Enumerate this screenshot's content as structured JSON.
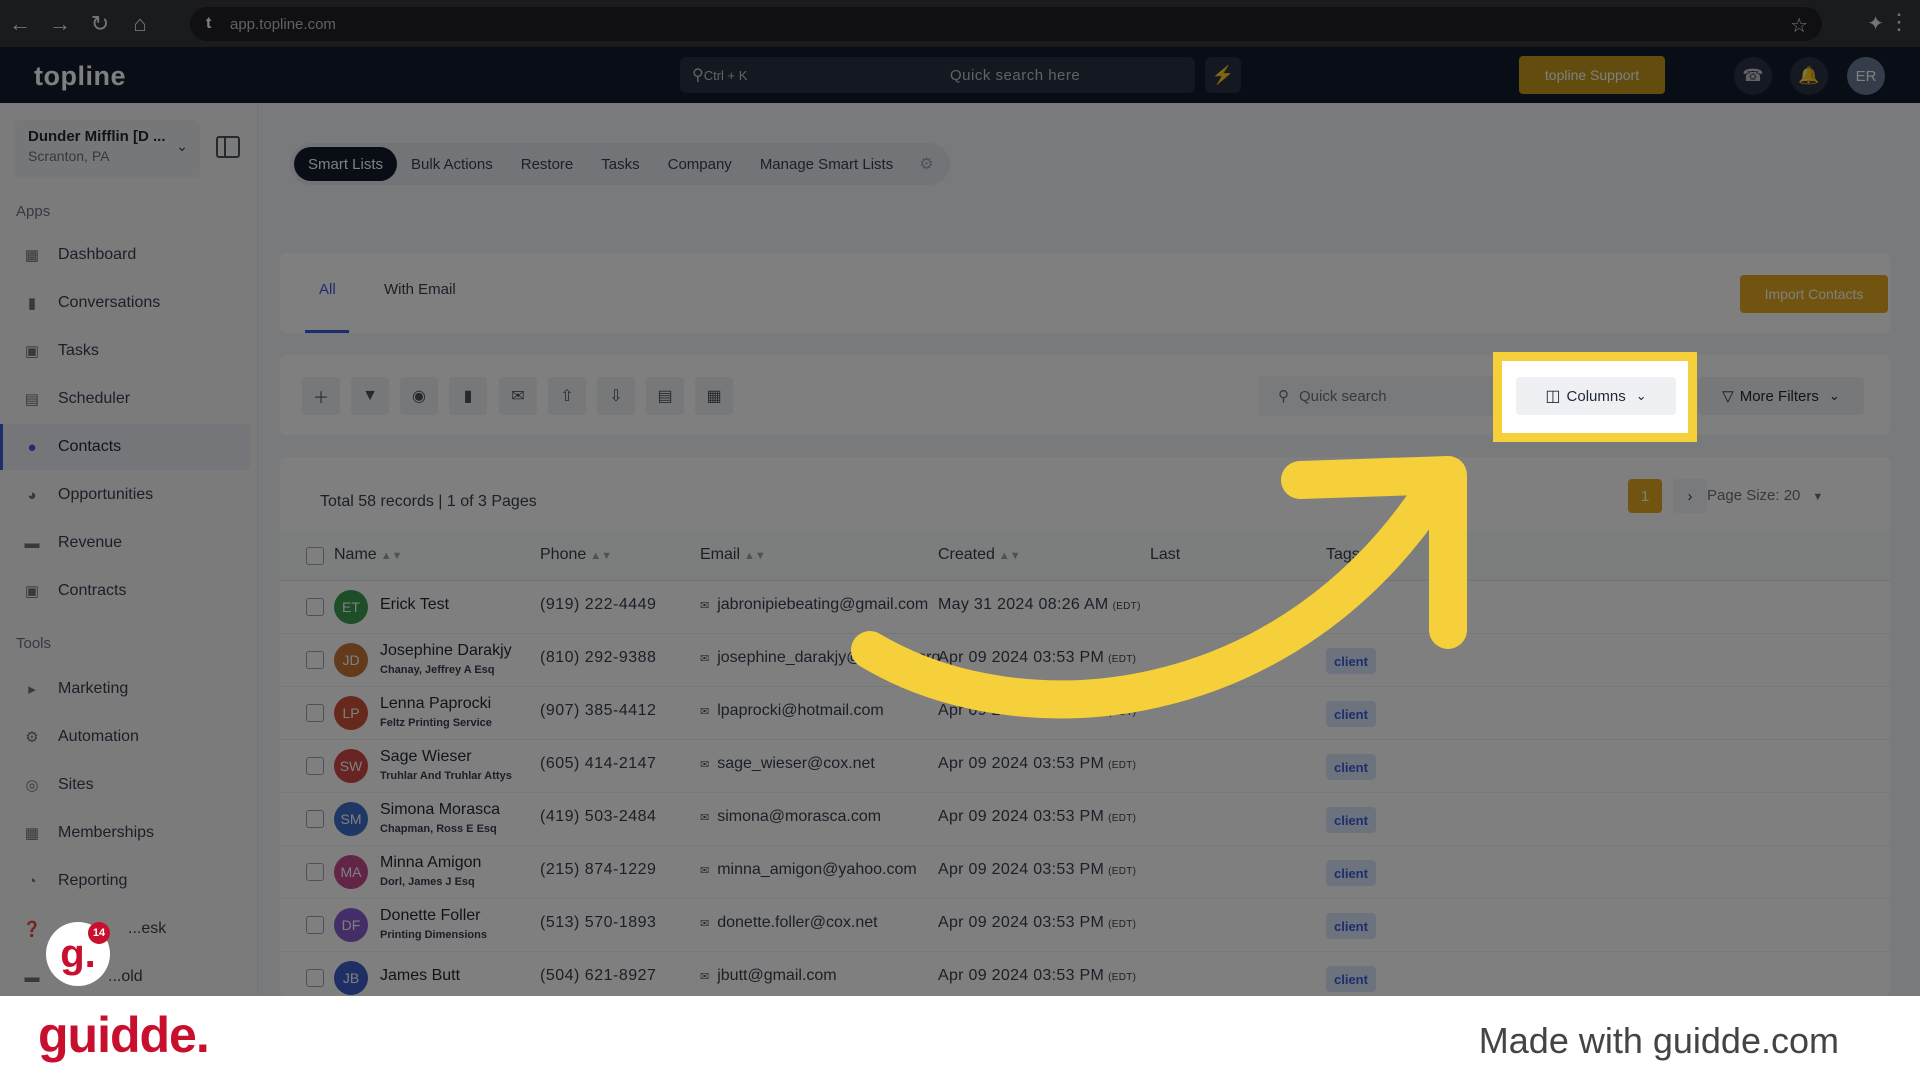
{
  "browser": {
    "url": "app.topline.com",
    "favicon": "t"
  },
  "app": {
    "logo": "topline",
    "search_placeholder": "Quick search here",
    "search_shortcut": "Ctrl + K",
    "support_label": "topline Support",
    "avatar_initials": "ER"
  },
  "sidebar": {
    "location_name": "Dunder Mifflin [D ...",
    "location_sub": "Scranton, PA",
    "apps_label": "Apps",
    "tools_label": "Tools",
    "apps": [
      {
        "label": "Dashboard",
        "icon": "dashboard-icon"
      },
      {
        "label": "Conversations",
        "icon": "chat-icon"
      },
      {
        "label": "Tasks",
        "icon": "tasks-icon"
      },
      {
        "label": "Scheduler",
        "icon": "calendar-icon"
      },
      {
        "label": "Contacts",
        "icon": "contacts-icon"
      },
      {
        "label": "Opportunities",
        "icon": "opportunities-icon"
      },
      {
        "label": "Revenue",
        "icon": "revenue-icon"
      },
      {
        "label": "Contracts",
        "icon": "contracts-icon"
      }
    ],
    "tools": [
      {
        "label": "Marketing",
        "icon": "megaphone-icon"
      },
      {
        "label": "Automation",
        "icon": "automation-icon"
      },
      {
        "label": "Sites",
        "icon": "globe-icon"
      },
      {
        "label": "Memberships",
        "icon": "memberships-icon"
      },
      {
        "label": "Reporting",
        "icon": "reporting-icon"
      },
      {
        "label": "...esk",
        "icon": "helpdesk-icon"
      },
      {
        "label": "...old",
        "icon": "misc-icon"
      }
    ]
  },
  "subnav": [
    "Smart Lists",
    "Bulk Actions",
    "Restore",
    "Tasks",
    "Company",
    "Manage Smart Lists"
  ],
  "tabs": [
    "All",
    "With Email"
  ],
  "import_label": "Import Contacts",
  "toolbar": {
    "quick_search": "Quick search",
    "columns_label": "Columns",
    "more_filters_label": "More Filters"
  },
  "table": {
    "total_text": "Total 58 records | 1 of 3 Pages",
    "current_page": "1",
    "page_size_text": "Page Size: 20",
    "headers": [
      "Name",
      "Phone",
      "Email",
      "Created",
      "Last",
      "Tags"
    ],
    "rows": [
      {
        "initials": "ET",
        "color": "#3a9d4f",
        "name": "Erick Test",
        "company": "",
        "phone": "(919) 222-4449",
        "email": "jabronipiebeating@gmail.com",
        "created": "May 31 2024 08:26 AM",
        "tz": "(EDT)",
        "tag": ""
      },
      {
        "initials": "JD",
        "color": "#c9743a",
        "name": "Josephine Darakjy",
        "company": "Chanay, Jeffrey A Esq",
        "phone": "(810) 292-9388",
        "email": "josephine_darakjy@darakjy.org",
        "created": "Apr 09 2024 03:53 PM",
        "tz": "(EDT)",
        "tag": "client"
      },
      {
        "initials": "LP",
        "color": "#d0533b",
        "name": "Lenna Paprocki",
        "company": "Feltz Printing Service",
        "phone": "(907) 385-4412",
        "email": "lpaprocki@hotmail.com",
        "created": "Apr 09 2024 03:53 PM",
        "tz": "(EDT)",
        "tag": "client"
      },
      {
        "initials": "SW",
        "color": "#d04646",
        "name": "Sage Wieser",
        "company": "Truhlar And Truhlar Attys",
        "phone": "(605) 414-2147",
        "email": "sage_wieser@cox.net",
        "created": "Apr 09 2024 03:53 PM",
        "tz": "(EDT)",
        "tag": "client"
      },
      {
        "initials": "SM",
        "color": "#3f6ec9",
        "name": "Simona Morasca",
        "company": "Chapman, Ross E Esq",
        "phone": "(419) 503-2484",
        "email": "simona@morasca.com",
        "created": "Apr 09 2024 03:53 PM",
        "tz": "(EDT)",
        "tag": "client"
      },
      {
        "initials": "MA",
        "color": "#c64a8a",
        "name": "Minna Amigon",
        "company": "Dorl, James J Esq",
        "phone": "(215) 874-1229",
        "email": "minna_amigon@yahoo.com",
        "created": "Apr 09 2024 03:53 PM",
        "tz": "(EDT)",
        "tag": "client"
      },
      {
        "initials": "DF",
        "color": "#8a5bd0",
        "name": "Donette Foller",
        "company": "Printing Dimensions",
        "phone": "(513) 570-1893",
        "email": "donette.foller@cox.net",
        "created": "Apr 09 2024 03:53 PM",
        "tz": "(EDT)",
        "tag": "client"
      },
      {
        "initials": "JB",
        "color": "#3f5cc9",
        "name": "James Butt",
        "company": "",
        "phone": "(504) 621-8927",
        "email": "jbutt@gmail.com",
        "created": "Apr 09 2024 03:53 PM",
        "tz": "(EDT)",
        "tag": "client"
      }
    ]
  },
  "guidde": {
    "badge": "g.",
    "badge_count": "14",
    "logo": "guidde.",
    "made_with": "Made with guidde.com"
  },
  "colors": {
    "highlight": "#f6d03a",
    "accent": "#3b5bdb",
    "brand": "#e3a820"
  }
}
